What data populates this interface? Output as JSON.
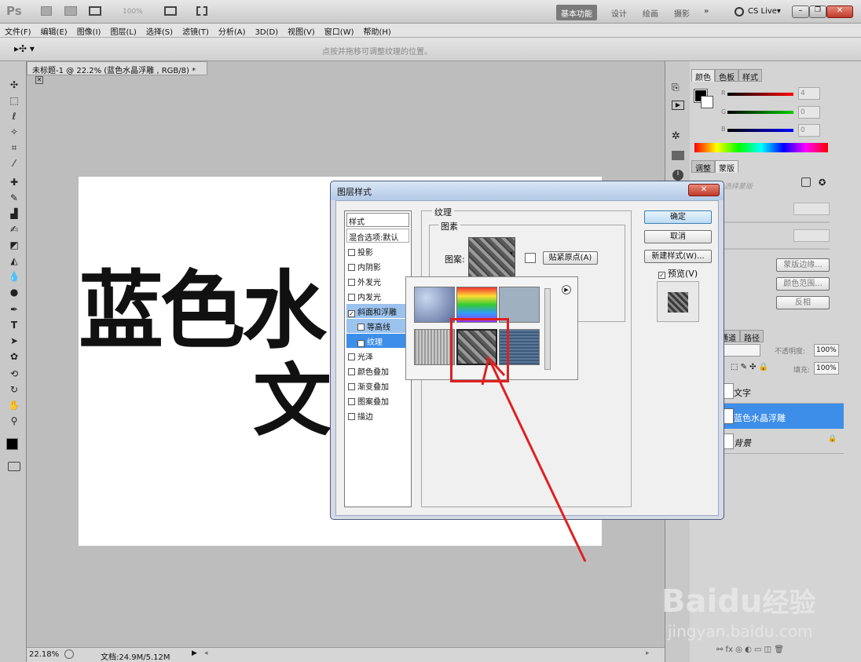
{
  "app": {
    "logo": "Ps",
    "zoom_menu": "100%",
    "workspaces": [
      "基本功能",
      "设计",
      "绘画",
      "摄影"
    ],
    "more": "»",
    "cslive": "CS Live▾"
  },
  "menu": [
    "文件(F)",
    "编辑(E)",
    "图像(I)",
    "图层(L)",
    "选择(S)",
    "滤镜(T)",
    "分析(A)",
    "3D(D)",
    "视图(V)",
    "窗口(W)",
    "帮助(H)"
  ],
  "options_bar": {
    "hint": "点按并拖移可调整纹理的位置。"
  },
  "document": {
    "tab_title": "未标题-1 @ 22.2% (蓝色水晶浮雕 , RGB/8) *",
    "canvas_text_line1": "蓝色水",
    "canvas_text_line2": "文",
    "zoom": "22.18%",
    "doc_size": "文档:24.9M/5.12M"
  },
  "panels": {
    "color_tabs": [
      "颜色",
      "色板",
      "样式"
    ],
    "rgb_labels": [
      "R",
      "G",
      "B"
    ],
    "rgb_values": [
      "4",
      "0",
      "0"
    ],
    "adjust_tabs": [
      "调整",
      "蒙版"
    ],
    "mask_text": "选择蒙版",
    "mask_buttons": [
      "蒙版边缘...",
      "颜色范围...",
      "反相"
    ],
    "layers_tabs": [
      "通道",
      "路径"
    ],
    "opacity_label": "不透明度:",
    "opacity_value": "100%",
    "fill_label": "填充:",
    "fill_value": "100%",
    "layers": [
      "文字",
      "蓝色水晶浮雕",
      "背景"
    ]
  },
  "dialog": {
    "title": "图层样式",
    "list_header": "样式",
    "blend": "混合选项:默认",
    "styles": [
      "投影",
      "内阴影",
      "外发光",
      "内发光",
      "斜面和浮雕",
      "等高线",
      "纹理",
      "光泽",
      "颜色叠加",
      "渐变叠加",
      "图案叠加",
      "描边"
    ],
    "checked": [
      false,
      false,
      false,
      false,
      true,
      false,
      true,
      false,
      false,
      false,
      false,
      false
    ],
    "section_title": "纹理",
    "group_title": "图素",
    "pattern_label": "图案:",
    "snap_button": "贴紧原点(A)",
    "ok": "确定",
    "cancel": "取消",
    "new_style": "新建样式(W)...",
    "preview_label": "预览(V)"
  },
  "watermark": {
    "brand": "Bai",
    "brand_du": "du",
    "brand_cn": "经验",
    "url": "jingyan.baidu.com"
  },
  "colors": {
    "accent_red": "#e02020",
    "selection_blue": "#3d8ee8"
  }
}
